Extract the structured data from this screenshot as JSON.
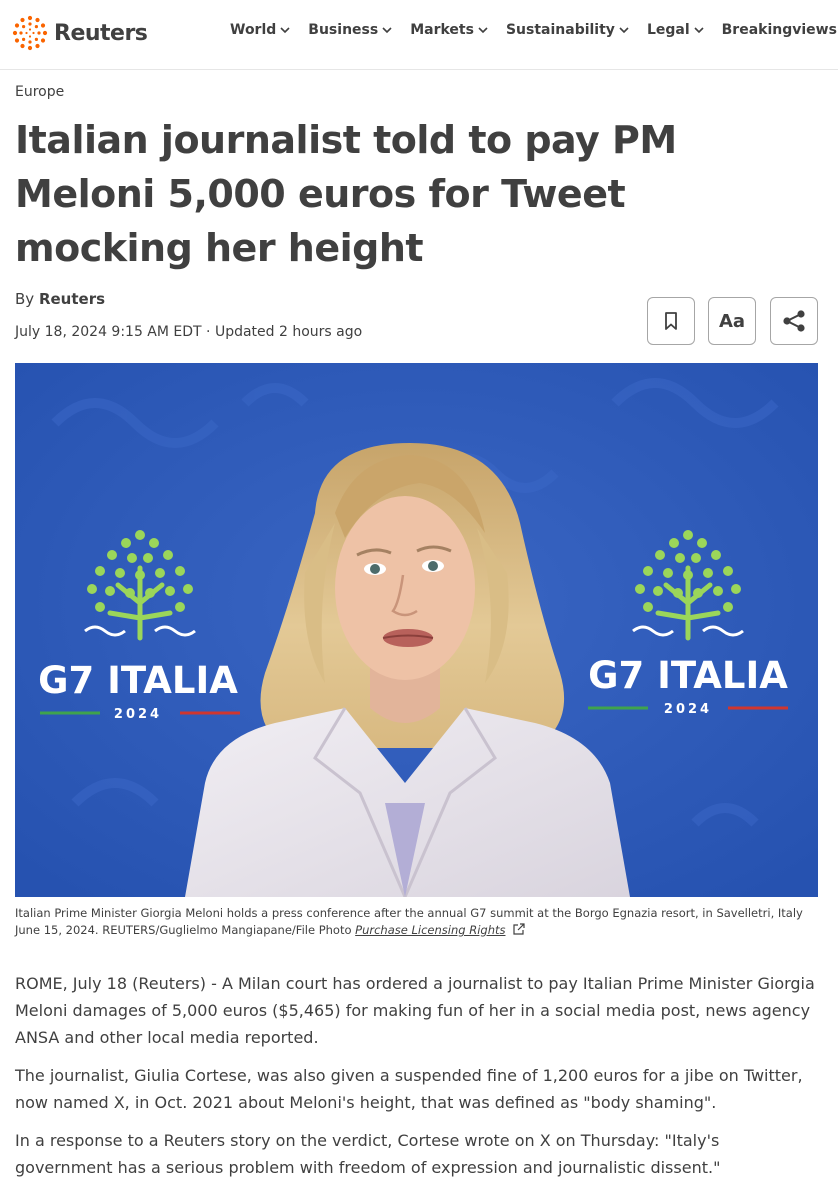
{
  "header": {
    "brand": "Reuters",
    "nav": [
      "World",
      "Business",
      "Markets",
      "Sustainability",
      "Legal",
      "Breakingviews"
    ]
  },
  "article": {
    "section": "Europe",
    "headline": "Italian journalist told to pay PM Meloni 5,000 euros for Tweet mocking her height",
    "byline_prefix": "By",
    "byline_author": "Reuters",
    "dateline": "July 18, 2024 9:15 AM EDT · Updated 2 hours ago",
    "tools": {
      "text_size_label": "Aa"
    }
  },
  "photo": {
    "backdrop_text": "G7 ITALIA",
    "backdrop_year": "2024",
    "caption": "Italian Prime Minister Giorgia Meloni holds a press conference after the annual G7 summit at the Borgo Egnazia resort, in Savelletri, Italy June 15, 2024. REUTERS/Guglielmo Mangiapane/File Photo",
    "licensing_link": "Purchase Licensing Rights"
  },
  "body": {
    "paragraphs": [
      "ROME, July 18 (Reuters) - A Milan court has ordered a journalist to pay Italian Prime Minister Giorgia Meloni damages of 5,000 euros ($5,465) for making fun of her in a social media post, news agency ANSA and other local media reported.",
      "The journalist, Giulia Cortese, was also given a suspended fine of 1,200 euros for a jibe on Twitter, now named X, in Oct. 2021 about Meloni's height, that was defined as \"body shaming\".",
      "In a response to a Reuters story on the verdict, Cortese wrote on X on Thursday: \"Italy's government has a serious problem with freedom of expression and journalistic dissent.\""
    ]
  },
  "colors": {
    "accent": "#fa6400",
    "text": "#404040",
    "backdrop_blue": "#2d5ab8",
    "logo_green": "#9bd65a"
  }
}
